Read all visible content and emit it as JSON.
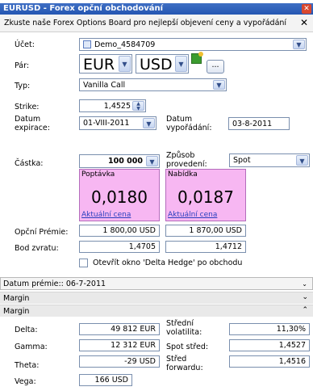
{
  "window": {
    "title": "EURUSD - Forex opční obchodování"
  },
  "banner": {
    "text": "Zkuste naše Forex Options Board pro nejlepší objevení ceny a vypořádání"
  },
  "form": {
    "account_label": "Účet:",
    "account_value": "Demo_4584709",
    "pair_label": "Pár:",
    "pair_base": "EUR",
    "pair_quote": "USD",
    "more_button": "...",
    "type_label": "Typ:",
    "type_value": "Vanilla Call",
    "strike_label": "Strike:",
    "strike_value": "1,4525",
    "expiry_label": "Datum expirace:",
    "expiry_value": "01-VIII-2011",
    "settle_label": "Datum vypořádání:",
    "settle_value": "03-8-2011",
    "amount_label": "Částka:",
    "amount_value": "100 000",
    "exec_label": "Způsob provedení:",
    "exec_value": "Spot"
  },
  "quotes": {
    "bid": {
      "head": "Poptávka",
      "value": "0,0180",
      "link": "Aktuální cena"
    },
    "ask": {
      "head": "Nabídka",
      "value": "0,0187",
      "link": "Aktuální cena"
    }
  },
  "premium": {
    "label": "Opční Prémie:",
    "bid": "1 800,00 USD",
    "ask": "1 870,00 USD"
  },
  "breakeven": {
    "label": "Bod zvratu:",
    "bid": "1,4705",
    "ask": "1,4712"
  },
  "delta_hedge": {
    "label": "Otevřít okno 'Delta Hedge' po obchodu",
    "checked": false
  },
  "premium_date": {
    "text": "Datum prémie:: 06-7-2011"
  },
  "sections": {
    "margin_collapsed": "Margin",
    "margin_expanded": "Margin"
  },
  "greeks": {
    "delta_label": "Delta:",
    "delta_value": "49 812 EUR",
    "gamma_label": "Gamma:",
    "gamma_value": "12 312 EUR",
    "theta_label": "Theta:",
    "theta_value": "-29 USD",
    "vega_label": "Vega:",
    "vega_value": "166 USD",
    "vol_label": "Střední volatilita:",
    "vol_value": "11,30%",
    "spot_label": "Spot střed:",
    "spot_value": "1,4527",
    "fwd_label": "Střed forwardu:",
    "fwd_value": "1,4516"
  }
}
